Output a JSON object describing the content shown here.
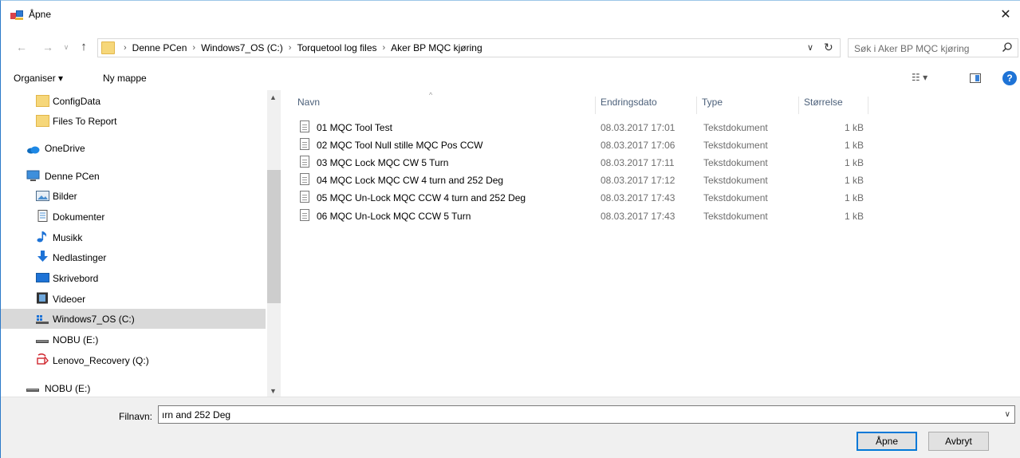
{
  "window": {
    "title": "Åpne",
    "close": "✕"
  },
  "nav": {
    "back": "←",
    "forward": "→",
    "recent": "∨",
    "up": "↑",
    "breadcrumbs": [
      "Denne PCen",
      "Windows7_OS (C:)",
      "Torquetool log files",
      "Aker BP MQC kjøring"
    ],
    "separator": "›",
    "dropdown": "∨",
    "refresh": "↻",
    "search_placeholder": "Søk i Aker BP MQC kjøring"
  },
  "toolbar": {
    "organise": "Organiser ▾",
    "new_folder": "Ny mappe",
    "view": "☷ ▾",
    "help": "?"
  },
  "sidebar": {
    "items": [
      {
        "label": "ConfigData",
        "icon": "folder-icon"
      },
      {
        "label": "Files To Report",
        "icon": "folder-icon"
      },
      {
        "label": "OneDrive",
        "icon": "onedrive-icon"
      },
      {
        "label": "Denne PCen",
        "icon": "computer-icon"
      },
      {
        "label": "Bilder",
        "icon": "pictures-icon"
      },
      {
        "label": "Dokumenter",
        "icon": "documents-icon"
      },
      {
        "label": "Musikk",
        "icon": "music-icon"
      },
      {
        "label": "Nedlastinger",
        "icon": "downloads-icon"
      },
      {
        "label": "Skrivebord",
        "icon": "desktop-icon"
      },
      {
        "label": "Videoer",
        "icon": "videos-icon"
      },
      {
        "label": "Windows7_OS (C:)",
        "icon": "windows-drive-icon",
        "selected": true
      },
      {
        "label": "NOBU (E:)",
        "icon": "usb-drive-icon"
      },
      {
        "label": "Lenovo_Recovery (Q:)",
        "icon": "recovery-drive-icon"
      },
      {
        "label": "NOBU (E:)",
        "icon": "usb-drive-icon"
      }
    ],
    "scroll_up": "▲",
    "scroll_down": "▼"
  },
  "filelist": {
    "sort_indicator": "^",
    "columns": {
      "name": "Navn",
      "date": "Endringsdato",
      "type": "Type",
      "size": "Størrelse"
    },
    "rows": [
      {
        "name": "01 MQC Tool Test",
        "date": "08.03.2017 17:01",
        "type": "Tekstdokument",
        "size": "1 kB"
      },
      {
        "name": "02 MQC Tool Null stille MQC Pos CCW",
        "date": "08.03.2017 17:06",
        "type": "Tekstdokument",
        "size": "1 kB"
      },
      {
        "name": "03 MQC Lock MQC CW 5 Turn",
        "date": "08.03.2017 17:11",
        "type": "Tekstdokument",
        "size": "1 kB"
      },
      {
        "name": "04 MQC Lock MQC CW 4 turn and 252 Deg",
        "date": "08.03.2017 17:12",
        "type": "Tekstdokument",
        "size": "1 kB"
      },
      {
        "name": "05 MQC Un-Lock MQC CCW 4 turn and 252 Deg",
        "date": "08.03.2017 17:43",
        "type": "Tekstdokument",
        "size": "1 kB"
      },
      {
        "name": "06 MQC Un-Lock MQC CCW 5 Turn",
        "date": "08.03.2017 17:43",
        "type": "Tekstdokument",
        "size": "1 kB"
      }
    ]
  },
  "footer": {
    "filename_label": "Filnavn:",
    "filename_value": "ırn and 252 Deg",
    "filename_dropdown": "∨",
    "open": "Åpne",
    "cancel": "Avbryt"
  },
  "colors": {
    "selection": "#d9d9d9",
    "accent": "#0078d7",
    "header_text": "#4c607a"
  }
}
